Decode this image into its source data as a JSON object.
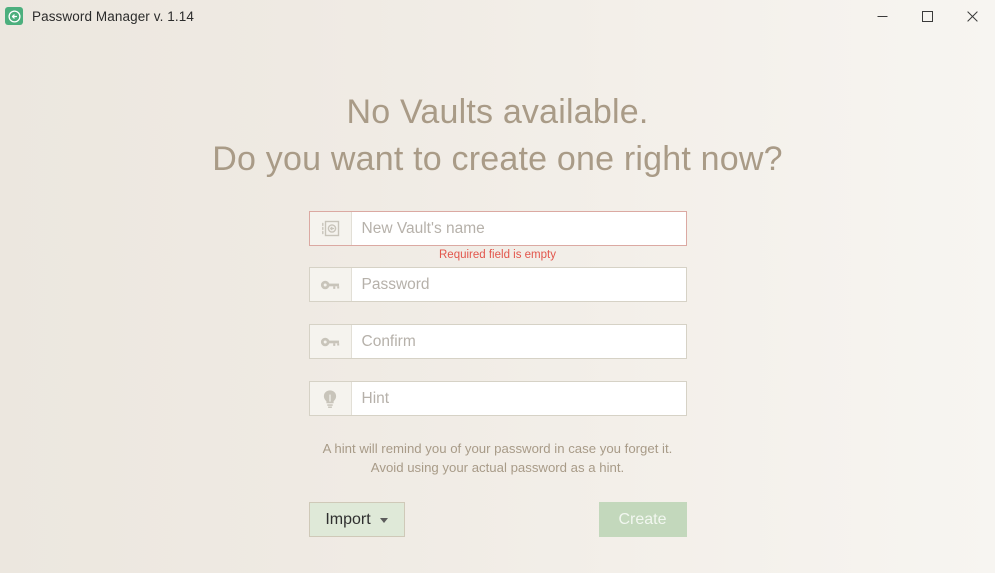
{
  "window": {
    "title": "Password Manager v. 1.14",
    "app_icon": "vault-app-icon",
    "controls": {
      "minimize": "minimize-icon",
      "maximize": "maximize-icon",
      "close": "close-icon"
    },
    "accent_green": "#4caf7d",
    "background_left": "#ece7df",
    "background_right": "#f7f5f1"
  },
  "headline": {
    "line1": "No Vaults available.",
    "line2": "Do you want to create one right now?",
    "color": "#a99b87"
  },
  "form": {
    "vault_name": {
      "placeholder": "New Vault's name",
      "value": "",
      "icon": "vault-icon",
      "error": "Required field is empty",
      "error_color": "#e2564c"
    },
    "password": {
      "placeholder": "Password",
      "value": "",
      "icon": "key-icon"
    },
    "confirm": {
      "placeholder": "Confirm",
      "value": "",
      "icon": "key-icon"
    },
    "hint": {
      "placeholder": "Hint",
      "value": "",
      "icon": "lightbulb-icon"
    },
    "note_line1": "A hint will remind you of your password in case you forget it.",
    "note_line2": "Avoid using your actual password as a hint."
  },
  "buttons": {
    "import_label": "Import",
    "import_caret": "chevron-down-icon",
    "import_bg": "#dfe9d8",
    "create_label": "Create",
    "create_bg": "#c3d8bc",
    "create_enabled": false
  }
}
